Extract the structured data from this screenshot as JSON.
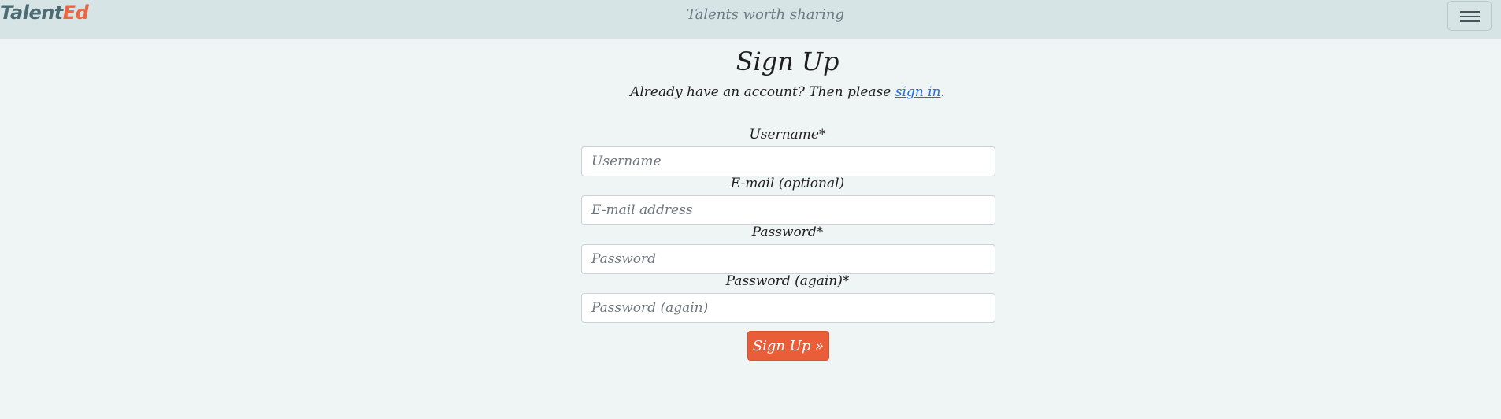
{
  "brand": {
    "text_main": "Talent",
    "text_accent": "Ed"
  },
  "header": {
    "tagline": "Talents worth sharing"
  },
  "nav": {
    "toggler_icon": "hamburger-menu-icon"
  },
  "page": {
    "title": "Sign Up",
    "intro_before": "Already have an account? Then please ",
    "intro_link": "sign in",
    "intro_after": "."
  },
  "form": {
    "username": {
      "label": "Username*",
      "placeholder": "Username",
      "value": ""
    },
    "email": {
      "label": "E-mail (optional)",
      "placeholder": "E-mail address",
      "value": ""
    },
    "password1": {
      "label": "Password*",
      "placeholder": "Password",
      "value": ""
    },
    "password2": {
      "label": "Password (again)*",
      "placeholder": "Password (again)",
      "value": ""
    },
    "submit_label": "Sign Up »"
  },
  "colors": {
    "navbar_bg": "#d7e4e6",
    "page_bg": "#eff4f4",
    "brand": "#4d6b73",
    "brand_accent": "#ee6541",
    "button": "#ea5d39",
    "link": "#1d6ee8"
  }
}
